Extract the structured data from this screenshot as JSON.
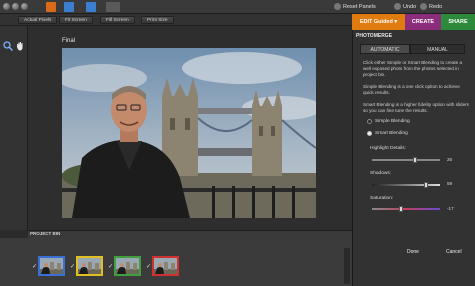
{
  "toolbar": {
    "reset_panels": "Reset Panels",
    "undo": "Undo",
    "redo": "Redo"
  },
  "view_buttons": [
    "Actual Pixels",
    "Fit Screen",
    "Fill Screen",
    "Print Size"
  ],
  "modes": {
    "edit_guided": "EDIT Guided",
    "create": "CREATE",
    "share": "SHARE",
    "colors": {
      "edit": "#e07b10",
      "create": "#8b2d7a",
      "share": "#2d8a3a"
    }
  },
  "canvas": {
    "label": "Final"
  },
  "panel": {
    "title": "PHOTOMERGE",
    "tabs": [
      "AUTOMATIC",
      "MANUAL"
    ],
    "active_tab": "AUTOMATIC",
    "intro": "Click either Simple or Smart Blending to create a well exposed photo from the photos selected in project bin.",
    "simple_desc": "Simple Blending is a one click option to achieve quick results.",
    "smart_desc": "Smart Blending is a higher fidelity option with sliders so you can fine tune the results.",
    "radio_simple": "Simple Blending",
    "radio_smart": "Smart Blending",
    "selected_mode": "Smart Blending",
    "sliders": [
      {
        "label": "Highlight Details:",
        "value": "26",
        "fraction": 0.63
      },
      {
        "label": "Shadows:",
        "value": "59",
        "fraction": 0.8
      },
      {
        "label": "Saturation:",
        "value": "-17",
        "fraction": 0.42
      }
    ],
    "done": "Done",
    "cancel": "Cancel"
  },
  "bin": {
    "title": "PROJECT BIN",
    "thumb_colors": [
      "#3a6fd8",
      "#e0c020",
      "#40a040",
      "#d03030"
    ]
  }
}
